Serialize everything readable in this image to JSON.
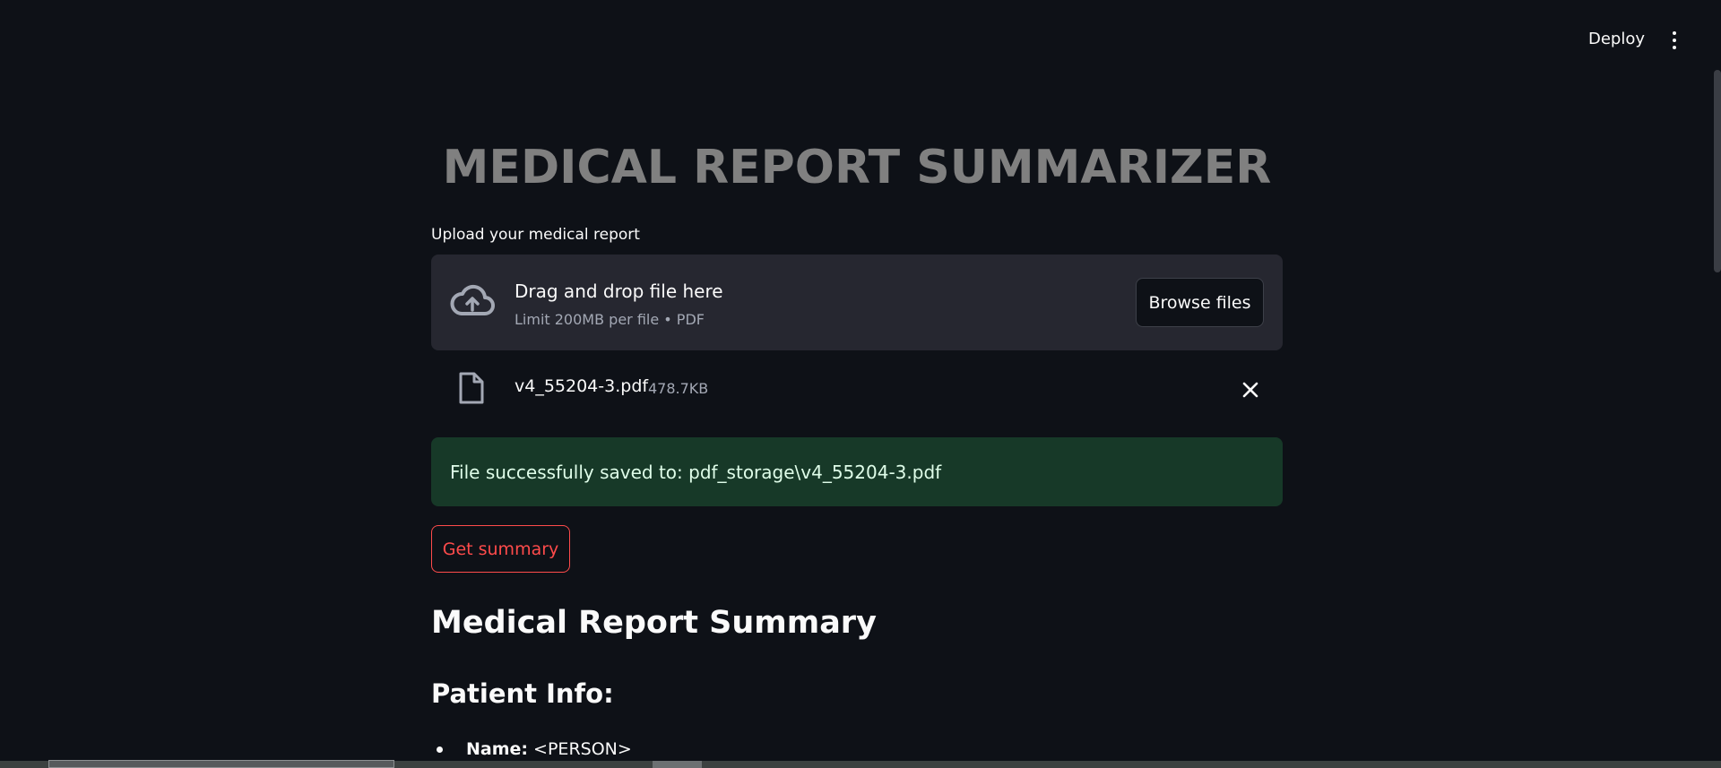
{
  "header": {
    "deploy_label": "Deploy",
    "menu_icon": "kebab-menu-icon"
  },
  "main": {
    "title": "MEDICAL REPORT SUMMARIZER",
    "uploader": {
      "label": "Upload your medical report",
      "drop_title": "Drag and drop file here",
      "drop_subtitle": "Limit 200MB per file • PDF",
      "browse_label": "Browse files",
      "icon": "cloud-upload-icon"
    },
    "uploaded_file": {
      "name": "v4_55204-3.pdf",
      "size": "478.7KB",
      "icon": "file-icon",
      "remove_icon": "close-icon"
    },
    "success_message": "File successfully saved to: pdf_storage\\v4_55204-3.pdf",
    "summary_button_label": "Get summary",
    "summary": {
      "heading": "Medical Report Summary",
      "subheading": "Patient Info:",
      "items": [
        {
          "key": "Name:",
          "value": " <PERSON>"
        }
      ]
    }
  },
  "colors": {
    "background": "#0e1117",
    "panel": "#262730",
    "success_bg": "#173928",
    "accent": "#ff4b4b",
    "title_gray": "#808080"
  }
}
